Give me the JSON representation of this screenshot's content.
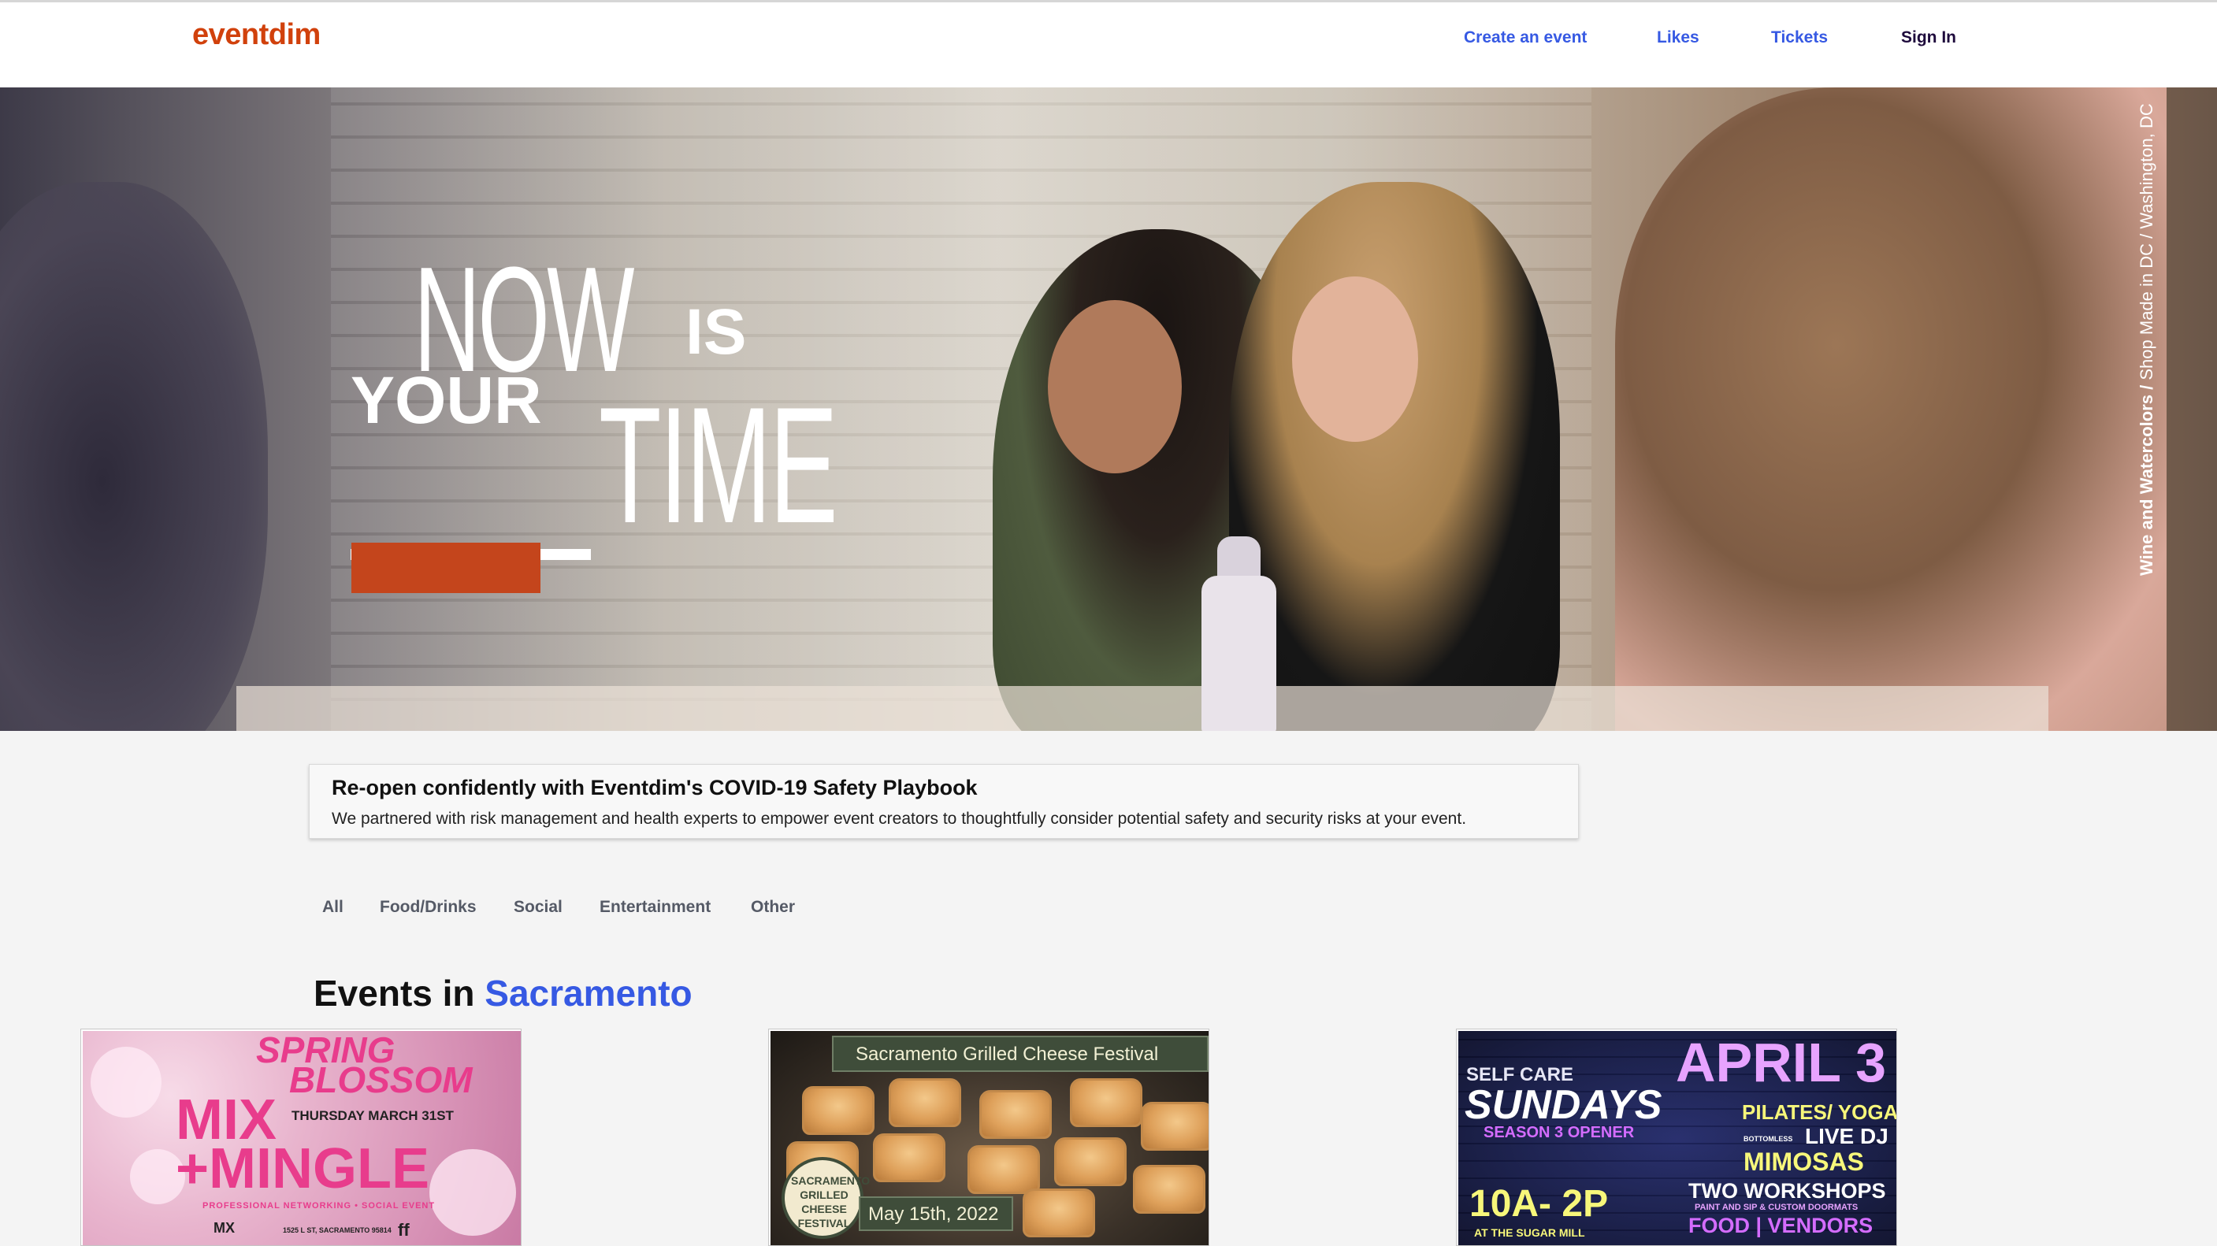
{
  "header": {
    "logo": "eventdim",
    "nav": {
      "create_event": "Create an event",
      "likes": "Likes",
      "tickets": "Tickets",
      "sign_in": "Sign In"
    }
  },
  "hero": {
    "tagline": {
      "now": "NOW",
      "is": "IS",
      "your": "YOUR",
      "time": "TIME"
    },
    "credit": {
      "event": "Wine and Watercolors",
      "sep": " / ",
      "place": "Shop Made in DC / Washington, DC"
    },
    "cta_color": "#c4451c"
  },
  "banner": {
    "title": "Re-open confidently with Eventdim's COVID-19 Safety Playbook",
    "body": "We partnered with risk management and health experts to empower event creators to thoughtfully consider potential safety and security risks at your event."
  },
  "tabs": [
    "All",
    "Food/Drinks",
    "Social",
    "Entertainment",
    "Other"
  ],
  "events": {
    "heading_prefix": "Events in",
    "city": "Sacramento",
    "cards": [
      {
        "lines": [
          "SPRING",
          "BLOSSOM",
          "THURSDAY MARCH 31ST",
          "MIX",
          "+MINGLE",
          "PROFESSIONAL NETWORKING • SOCIAL EVENT",
          "1525 L ST, SACRAMENTO 95814",
          "MX",
          "ff"
        ]
      },
      {
        "title": "Sacramento Grilled Cheese Festival",
        "date": "May 15th, 2022",
        "seal": [
          "SACRAMENTO",
          "GRILLED",
          "CHEESE",
          "FESTIVAL"
        ]
      },
      {
        "lines": [
          "SELF CARE",
          "SUNDAYS",
          "SEASON 3 OPENER",
          "APRIL 3",
          "PILATES/ YOGA",
          "BOTTOMLESS",
          "LIVE DJ",
          "MIMOSAS",
          "TWO WORKSHOPS",
          "PAINT AND SIP & CUSTOM DOORMATS",
          "10A- 2P",
          "FOOD | VENDORS",
          "AT THE SUGAR MILL"
        ]
      }
    ]
  },
  "colors": {
    "brand": "#d1410c",
    "link": "#3659e3"
  }
}
